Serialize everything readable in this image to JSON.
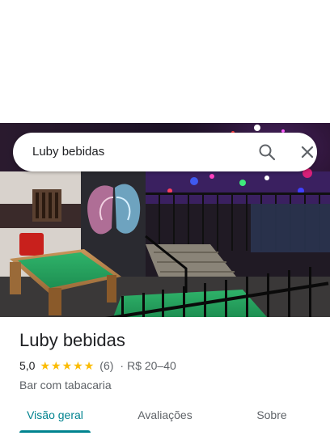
{
  "search": {
    "query": "Luby bebidas"
  },
  "place": {
    "title": "Luby bebidas",
    "rating": "5,0",
    "stars": 5,
    "review_count": "(6)",
    "separator": "·",
    "price_range": "R$ 20–40",
    "category": "Bar com tabacaria"
  },
  "tabs": [
    {
      "label": "Visão geral",
      "active": true
    },
    {
      "label": "Avaliações",
      "active": false
    },
    {
      "label": "Sobre",
      "active": false
    }
  ],
  "icons": {
    "search": "search-icon",
    "close": "close-icon",
    "star": "star-icon"
  },
  "colors": {
    "accent": "#00838f",
    "star": "#fbbc04",
    "text_primary": "#202124",
    "text_secondary": "#5f6368"
  }
}
